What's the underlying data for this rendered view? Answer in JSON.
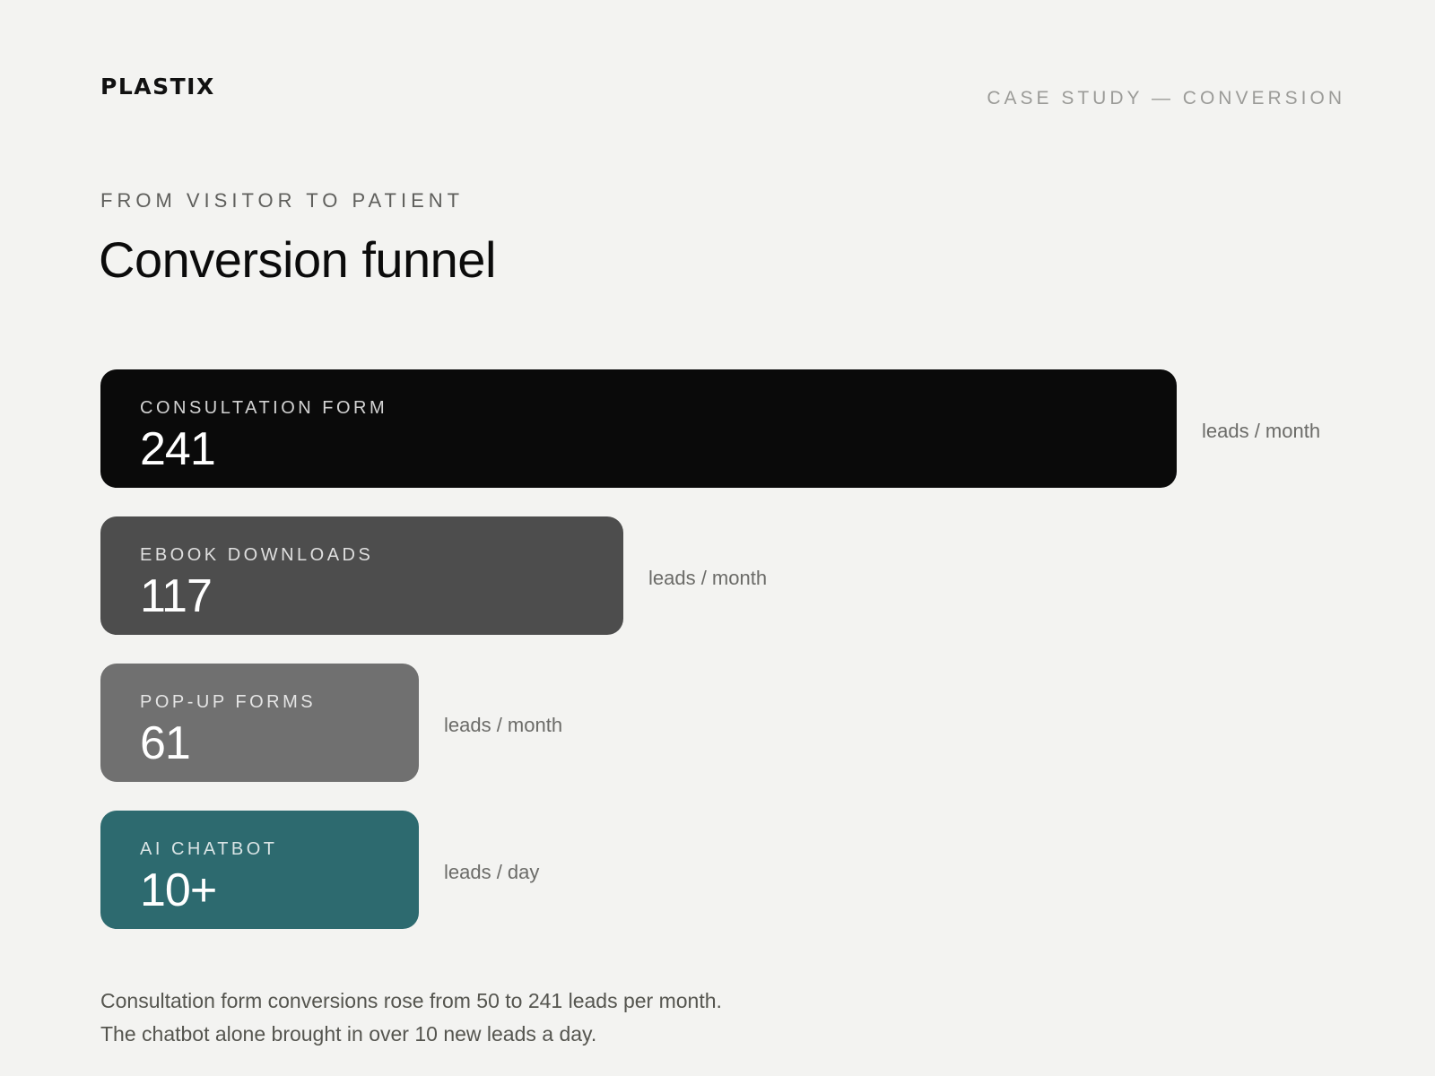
{
  "header": {
    "logo_text": "PLASTIX",
    "section_tag": "CASE STUDY — CONVERSION"
  },
  "eyebrow": "FROM VISITOR TO PATIENT",
  "title": "Conversion funnel",
  "summary": {
    "line1": "Consultation form conversions rose from 50 to 241 leads per month.",
    "line2": "The chatbot alone brought in over 10 new leads a day."
  },
  "chart_data": {
    "type": "bar",
    "orientation": "horizontal",
    "title": "Conversion funnel",
    "categories": [
      "CONSULTATION FORM",
      "EBOOK DOWNLOADS",
      "POP-UP FORMS",
      "AI CHATBOT"
    ],
    "values": [
      241,
      117,
      61,
      10
    ],
    "value_labels": [
      "241",
      "117",
      "61",
      "10+"
    ],
    "units": [
      "leads / month",
      "leads / month",
      "leads / month",
      "leads / day"
    ],
    "colors": [
      "#0a0a0a",
      "#4d4d4d",
      "#707070",
      "#2d6a6f"
    ],
    "xlim": [
      0,
      241
    ],
    "grid": false
  }
}
